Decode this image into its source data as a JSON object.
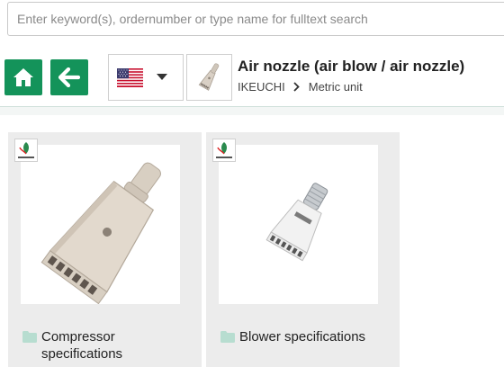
{
  "search": {
    "placeholder": "Enter keyword(s), ordernumber or type name for fulltext search"
  },
  "toolbar": {
    "home_icon": "home-icon",
    "back_icon": "arrow-left-icon",
    "language_flag": "us-flag-icon"
  },
  "product": {
    "title": "Air nozzle (air blow / air nozzle)",
    "breadcrumb": [
      "IKEUCHI",
      "Metric unit"
    ]
  },
  "categories": [
    {
      "label": "Compressor specifications",
      "icon": "folder-icon"
    },
    {
      "label": "Blower specifications",
      "icon": "folder-icon"
    }
  ],
  "colors": {
    "accent": "#14935a",
    "folder": "#b7ddd0"
  }
}
